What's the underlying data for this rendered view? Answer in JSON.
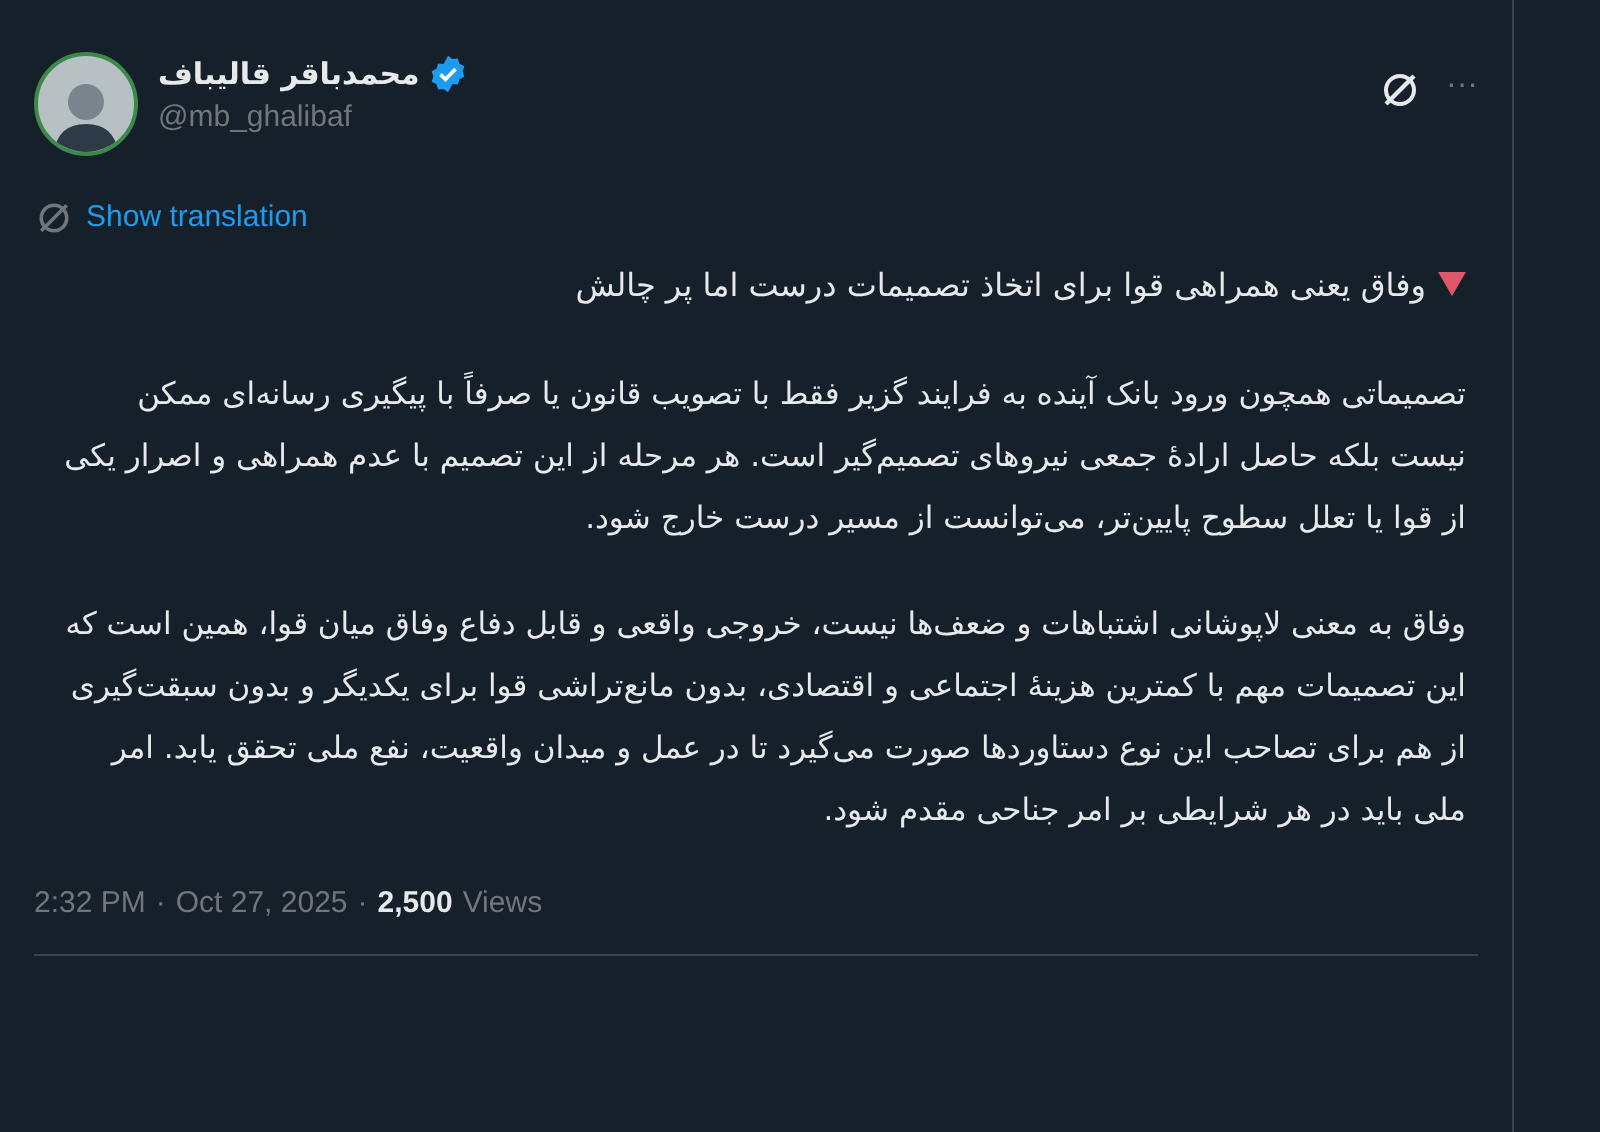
{
  "author": {
    "name": "محمدباقر قالیباف",
    "verified": true,
    "handle": "@mb_ghalibaf"
  },
  "more_menu": "···",
  "show_translation": "Show translation",
  "headline": "وفاق یعنی همراهی قوا برای اتخاذ تصمیمات درست اما پر چالش",
  "paragraphs": [
    "تصمیماتی همچون ورود بانک آینده به فرایند گزیر فقط با تصویب قانون یا صرفاً با پیگیری رسانه‌ای ممکن نیست بلکه حاصل ارادهٔ جمعی نیروهای تصمیم‌گیر است. هر مرحله از این تصمیم با عدم همراهی و اصرار یکی از قوا یا تعلل سطوح پایین‌تر، می‌توانست از مسیر درست خارج شود.",
    "وفاق به معنی لاپوشانی اشتباهات و ضعف‌ها نیست، خروجی واقعی و قابل دفاع وفاق میان قوا، همین است که این تصمیمات مهم با کمترین هزینهٔ اجتماعی و اقتصادی، بدون مانع‌تراشی قوا برای یکدیگر و بدون سبقت‌گیری از هم برای تصاحب این نوع دستاوردها صورت می‌گیرد  تا در عمل و میدان واقعیت، نفع ملی تحقق یابد. امر ملی باید در هر شرایطی بر امر جناحی مقدم شود."
  ],
  "meta": {
    "separator": "·",
    "time": "2:32 PM",
    "date": "Oct 27, 2025",
    "views_count": "2,500",
    "views_label": "Views"
  }
}
